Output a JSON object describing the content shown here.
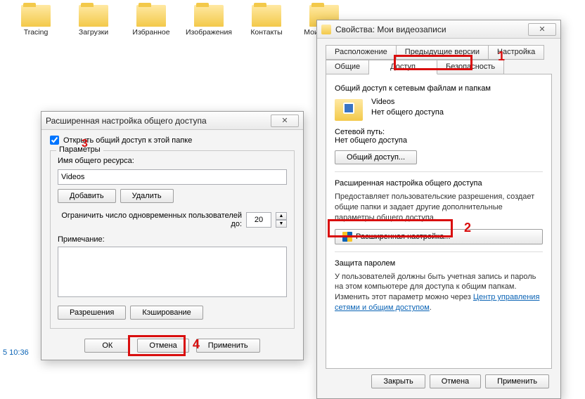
{
  "explorer_items": [
    "Tracing",
    "Загрузки",
    "Избранное",
    "Изображения",
    "Контакты",
    "Мои видеоз"
  ],
  "timestamp": "5 10:36",
  "properties": {
    "title": "Свойства: Мои видеозаписи",
    "tabs_row1": [
      "Расположение",
      "Предыдущие версии",
      "Настройка"
    ],
    "tabs_row2": [
      "Общие",
      "Доступ",
      "Безопасность"
    ],
    "section_network": "Общий доступ к сетевым файлам и папкам",
    "share_name": "Videos",
    "share_status": "Нет общего доступа",
    "netpath_label": "Сетевой путь:",
    "netpath_value": "Нет общего доступа",
    "btn_share": "Общий доступ...",
    "section_advanced": "Расширенная настройка общего доступа",
    "advanced_desc": "Предоставляет пользовательские разрешения, создает общие папки и задает другие дополнительные параметры общего доступа.",
    "btn_advanced": "Расширенная настройка...",
    "section_pwd": "Защита паролем",
    "pwd_desc": "У пользователей должны быть учетная запись и пароль на этом компьютере для доступа к общим папкам. Изменить этот параметр можно через ",
    "pwd_link": "Центр управления сетями и общим доступом",
    "btn_close": "Закрыть",
    "btn_cancel": "Отмена",
    "btn_apply": "Применить"
  },
  "advdlg": {
    "title": "Расширенная настройка общего доступа",
    "check_label": "Открыть общий доступ к этой папке",
    "group_label": "Параметры",
    "sharename_label": "Имя общего ресурса:",
    "sharename_value": "Videos",
    "btn_add": "Добавить",
    "btn_del": "Удалить",
    "limit_label": "Ограничить число одновременных пользователей до:",
    "limit_value": "20",
    "note_label": "Примечание:",
    "btn_perm": "Разрешения",
    "btn_cache": "Кэширование",
    "btn_ok": "ОК",
    "btn_cancel": "Отмена",
    "btn_apply": "Применить"
  },
  "annotations": {
    "n1": "1",
    "n2": "2",
    "n3": "3",
    "n4": "4"
  }
}
